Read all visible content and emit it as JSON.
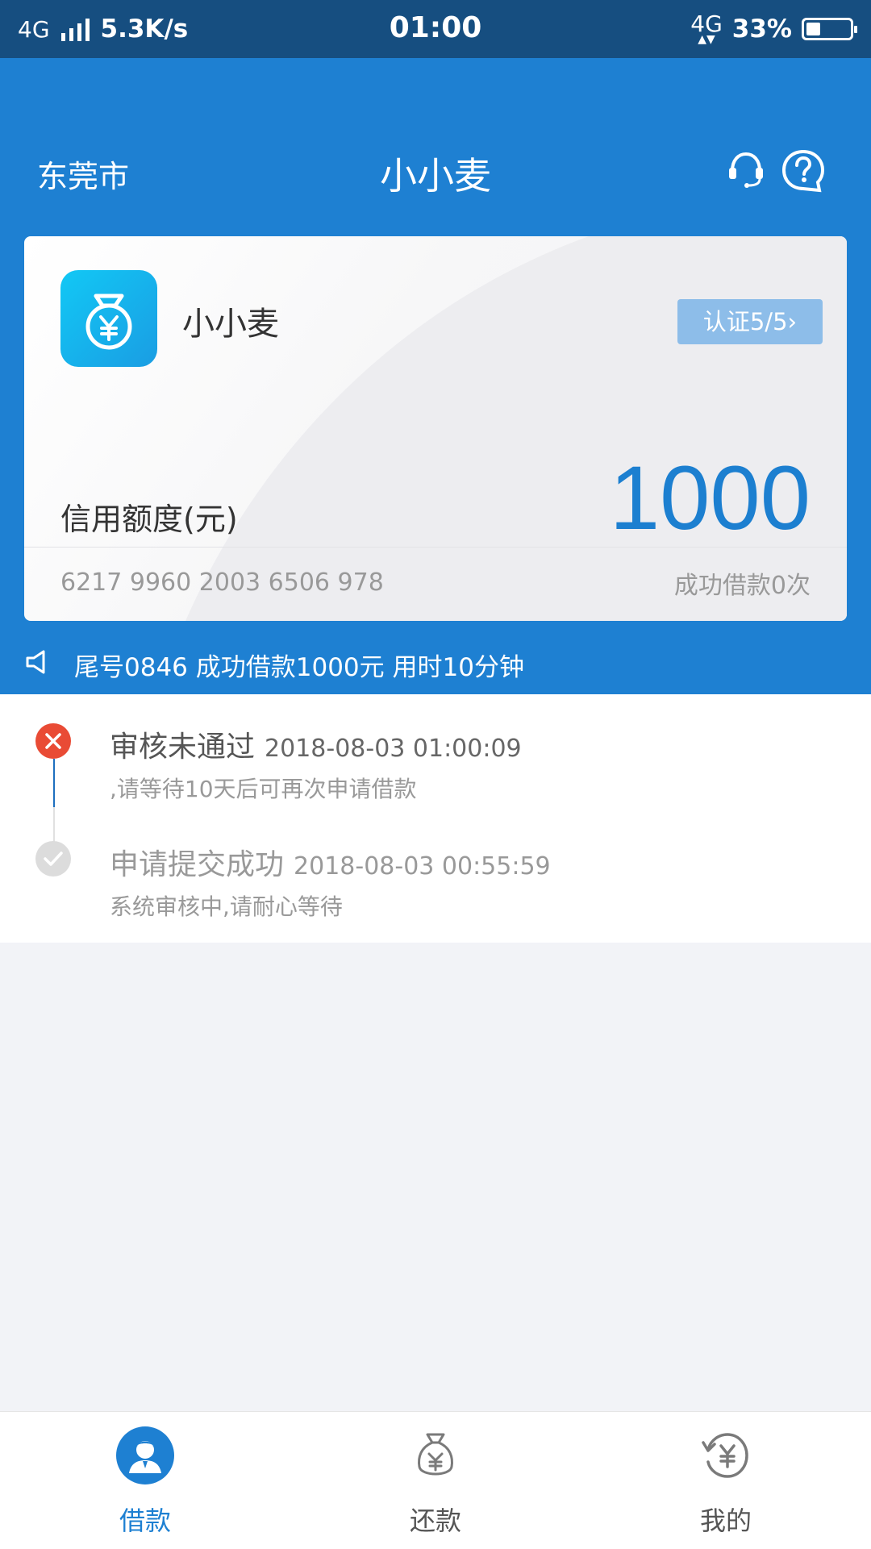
{
  "status_bar": {
    "network": "4G",
    "speed": "5.3K/s",
    "time": "01:00",
    "network_right": "4G",
    "battery_percent": "33%",
    "battery_level": 0.33
  },
  "nav": {
    "city": "东莞市",
    "title": "小小麦"
  },
  "card": {
    "app_name": "小小麦",
    "auth_badge": "认证5/5",
    "limit_label": "信用额度(元)",
    "limit_value": "1000",
    "account_number": "6217 9960 2003 6506 978",
    "loan_count": "成功借款0次"
  },
  "notice": {
    "text": "尾号0846 成功借款1000元 用时10分钟"
  },
  "timeline": [
    {
      "title": "审核未通过",
      "timestamp": "2018-08-03 01:00:09",
      "subtitle": ",请等待10天后可再次申请借款",
      "status": "failed"
    },
    {
      "title": "申请提交成功",
      "timestamp": "2018-08-03 00:55:59",
      "subtitle": "系统审核中,请耐心等待",
      "status": "done"
    }
  ],
  "tabs": [
    {
      "label": "借款",
      "icon": "user-avatar-icon",
      "active": true
    },
    {
      "label": "还款",
      "icon": "money-bag-icon",
      "active": false
    },
    {
      "label": "我的",
      "icon": "yuan-refresh-icon",
      "active": false
    }
  ],
  "colors": {
    "primary": "#1e80d2",
    "status_bar": "#164e80",
    "fail": "#e94b35",
    "limit_value": "#1c7fd0"
  }
}
